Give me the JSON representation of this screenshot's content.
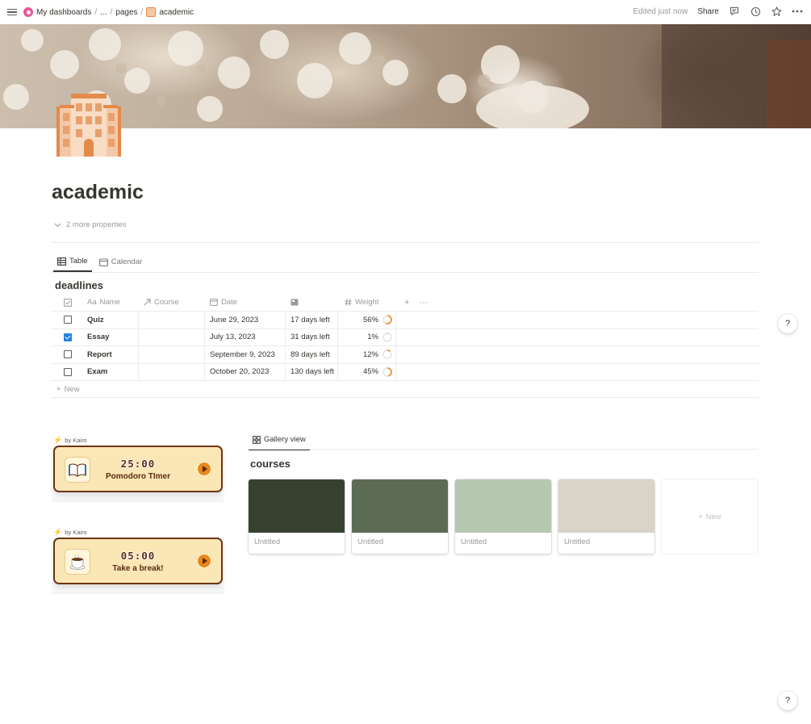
{
  "topbar": {
    "breadcrumbs": [
      "My dashboards",
      "...",
      "pages",
      "academic"
    ],
    "separator": "/",
    "edited": "Edited just now",
    "share": "Share"
  },
  "page": {
    "title": "academic",
    "more_properties": "2 more properties"
  },
  "views": {
    "tabs": [
      {
        "label": "Table",
        "icon": "table-icon",
        "active": true
      },
      {
        "label": "Calendar",
        "icon": "calendar-icon",
        "active": false
      }
    ]
  },
  "deadlines": {
    "title": "deadlines",
    "columns": {
      "name": "Name",
      "name_prefix": "Aa",
      "course": "Course",
      "date": "Date",
      "weight": "Weight",
      "add": "+",
      "more": "···"
    },
    "rows": [
      {
        "checked": false,
        "name": "Quiz",
        "course": "",
        "date": "June 29, 2023",
        "left": "17 days left",
        "weight": "56%",
        "weight_value": 0.56
      },
      {
        "checked": true,
        "name": "Essay",
        "course": "",
        "date": "July 13, 2023",
        "left": "31 days left",
        "weight": "1%",
        "weight_value": 0.01
      },
      {
        "checked": false,
        "name": "Report",
        "course": "",
        "date": "September 9, 2023",
        "left": "89 days left",
        "weight": "12%",
        "weight_value": 0.12
      },
      {
        "checked": false,
        "name": "Exam",
        "course": "",
        "date": "October 20, 2023",
        "left": "130 days left",
        "weight": "45%",
        "weight_value": 0.45
      }
    ],
    "new_label": "New"
  },
  "widgets": [
    {
      "by": "by Kairo",
      "time": "25:00",
      "subtitle": "Pomodoro TImer",
      "icon": "book-icon"
    },
    {
      "by": "by Kairo",
      "time": "05:00",
      "subtitle": "Take a break!",
      "icon": "coffee-icon"
    }
  ],
  "gallery": {
    "tab": "Gallery view",
    "title": "courses",
    "cards": [
      {
        "caption": "Untitled",
        "color": "#37412f"
      },
      {
        "caption": "Untitled",
        "color": "#5b6b56"
      },
      {
        "caption": "Untitled",
        "color": "#b6c8b2"
      },
      {
        "caption": "Untitled",
        "color": "#d8d4c7"
      }
    ],
    "new_label": "New"
  },
  "help": "?",
  "colors": {
    "accent_blue": "#2383e2",
    "widget_border": "#6b3516",
    "widget_bg": "#fbe6b5",
    "ring": "#e8891c"
  }
}
